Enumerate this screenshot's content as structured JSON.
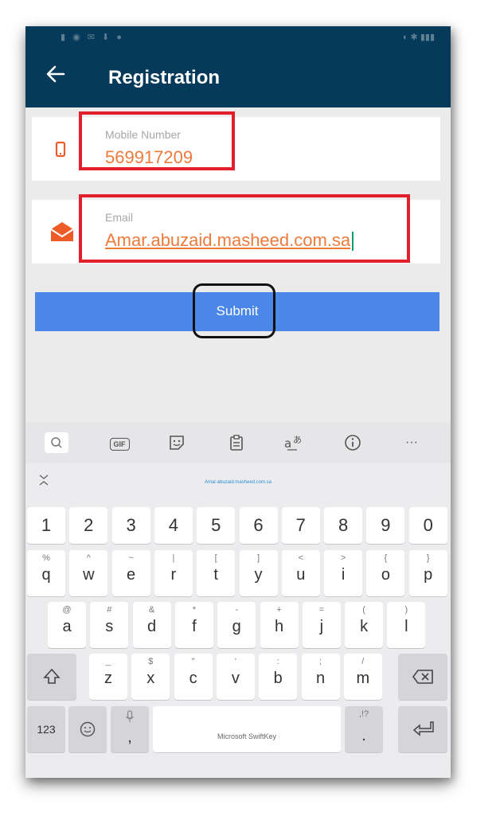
{
  "app": {
    "title": "Registration"
  },
  "form": {
    "mobile_label": "Mobile Number",
    "mobile_value": "569917209",
    "email_label": "Email",
    "email_value": "Amar.abuzaid.masheed.com.sa",
    "submit_label": "Submit"
  },
  "keyboard": {
    "toolbar_icons": [
      "search-icon",
      "gif-icon",
      "sticker-icon",
      "clipboard-icon",
      "translate-icon",
      "info-icon",
      "more-icon"
    ],
    "toolbar_gif": "GIF",
    "toolbar_more": "···",
    "suggestion": "Amar.abuzaid.masheed.com.sa",
    "number_row": [
      "1",
      "2",
      "3",
      "4",
      "5",
      "6",
      "7",
      "8",
      "9",
      "0"
    ],
    "row1": [
      {
        "k": "q",
        "s": "%"
      },
      {
        "k": "w",
        "s": "^"
      },
      {
        "k": "e",
        "s": "~"
      },
      {
        "k": "r",
        "s": "|"
      },
      {
        "k": "t",
        "s": "["
      },
      {
        "k": "y",
        "s": "]"
      },
      {
        "k": "u",
        "s": "<"
      },
      {
        "k": "i",
        "s": ">"
      },
      {
        "k": "o",
        "s": "{"
      },
      {
        "k": "p",
        "s": "}"
      }
    ],
    "row2": [
      {
        "k": "a",
        "s": "@"
      },
      {
        "k": "s",
        "s": "#"
      },
      {
        "k": "d",
        "s": "&"
      },
      {
        "k": "f",
        "s": "*"
      },
      {
        "k": "g",
        "s": "-"
      },
      {
        "k": "h",
        "s": "+"
      },
      {
        "k": "j",
        "s": "="
      },
      {
        "k": "k",
        "s": "("
      },
      {
        "k": "l",
        "s": ")"
      }
    ],
    "row3": [
      {
        "k": "z",
        "s": "_"
      },
      {
        "k": "x",
        "s": "$"
      },
      {
        "k": "c",
        "s": "\""
      },
      {
        "k": "v",
        "s": "'"
      },
      {
        "k": "b",
        "s": ":"
      },
      {
        "k": "n",
        "s": ";"
      },
      {
        "k": "m",
        "s": "/"
      }
    ],
    "key_123": "123",
    "comma": ",",
    "period": ".",
    "period_sub": ",!?",
    "space_label": "Microsoft SwiftKey"
  },
  "colors": {
    "appbar": "#063a5a",
    "accent_orange": "#ee7a3b",
    "submit_blue": "#4b87e8",
    "highlight_red": "#e1202b"
  }
}
